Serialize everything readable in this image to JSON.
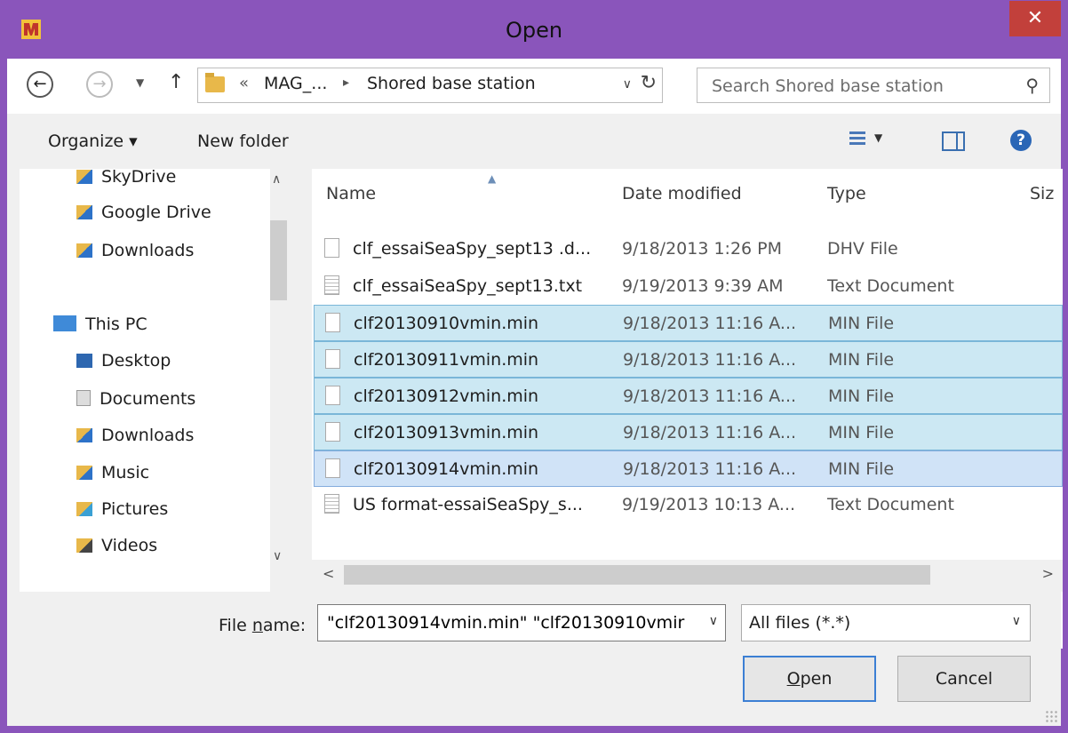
{
  "window": {
    "title": "Open",
    "close_label": "✕"
  },
  "address": {
    "breadcrumb_prefix": "«",
    "breadcrumb_parent": "MAG_...",
    "breadcrumb_arrow": "▸",
    "breadcrumb_current": "Shored base station",
    "search_placeholder": "Search Shored base station"
  },
  "toolbar": {
    "organize_label": "Organize ▾",
    "new_folder_label": "New folder",
    "help_label": "?"
  },
  "nav": {
    "items": [
      {
        "label": "SkyDrive",
        "icon": "skydrive-folder-icon"
      },
      {
        "label": "Google Drive",
        "icon": "google-drive-folder-icon"
      },
      {
        "label": "Downloads",
        "icon": "downloads-folder-icon"
      },
      {
        "label": "This PC",
        "icon": "this-pc-icon"
      },
      {
        "label": "Desktop",
        "icon": "desktop-folder-icon"
      },
      {
        "label": "Documents",
        "icon": "documents-folder-icon"
      },
      {
        "label": "Downloads",
        "icon": "downloads-folder-icon"
      },
      {
        "label": "Music",
        "icon": "music-folder-icon"
      },
      {
        "label": "Pictures",
        "icon": "pictures-folder-icon"
      },
      {
        "label": "Videos",
        "icon": "videos-folder-icon"
      }
    ]
  },
  "files": {
    "columns": {
      "name": "Name",
      "date": "Date modified",
      "type": "Type",
      "size": "Siz"
    },
    "rows": [
      {
        "name": "clf_essaiSeaSpy_sept13 .d...",
        "date": "9/18/2013 1:26 PM",
        "type": "DHV File",
        "selected": false
      },
      {
        "name": "clf_essaiSeaSpy_sept13.txt",
        "date": "9/19/2013 9:39 AM",
        "type": "Text Document",
        "selected": false
      },
      {
        "name": "clf20130910vmin.min",
        "date": "9/18/2013 11:16 A...",
        "type": "MIN File",
        "selected": true
      },
      {
        "name": "clf20130911vmin.min",
        "date": "9/18/2013 11:16 A...",
        "type": "MIN File",
        "selected": true
      },
      {
        "name": "clf20130912vmin.min",
        "date": "9/18/2013 11:16 A...",
        "type": "MIN File",
        "selected": true
      },
      {
        "name": "clf20130913vmin.min",
        "date": "9/18/2013 11:16 A...",
        "type": "MIN File",
        "selected": true
      },
      {
        "name": "clf20130914vmin.min",
        "date": "9/18/2013 11:16 A...",
        "type": "MIN File",
        "selected": true
      },
      {
        "name": "US format-essaiSeaSpy_s...",
        "date": "9/19/2013 10:13 A...",
        "type": "Text Document",
        "selected": false
      }
    ]
  },
  "bottom": {
    "file_name_label_pre": "File ",
    "file_name_label_u": "n",
    "file_name_label_post": "ame:",
    "file_name_value": "\"clf20130914vmin.min\" \"clf20130910vmir",
    "file_type_value": "All files (*.*)",
    "open_label_u": "O",
    "open_label_rest": "pen",
    "cancel_label": "Cancel"
  },
  "colors": {
    "titlebar": "#8a55bb",
    "close": "#c2403b",
    "selection": "#cce8f3",
    "accent": "#3c7fd4"
  }
}
